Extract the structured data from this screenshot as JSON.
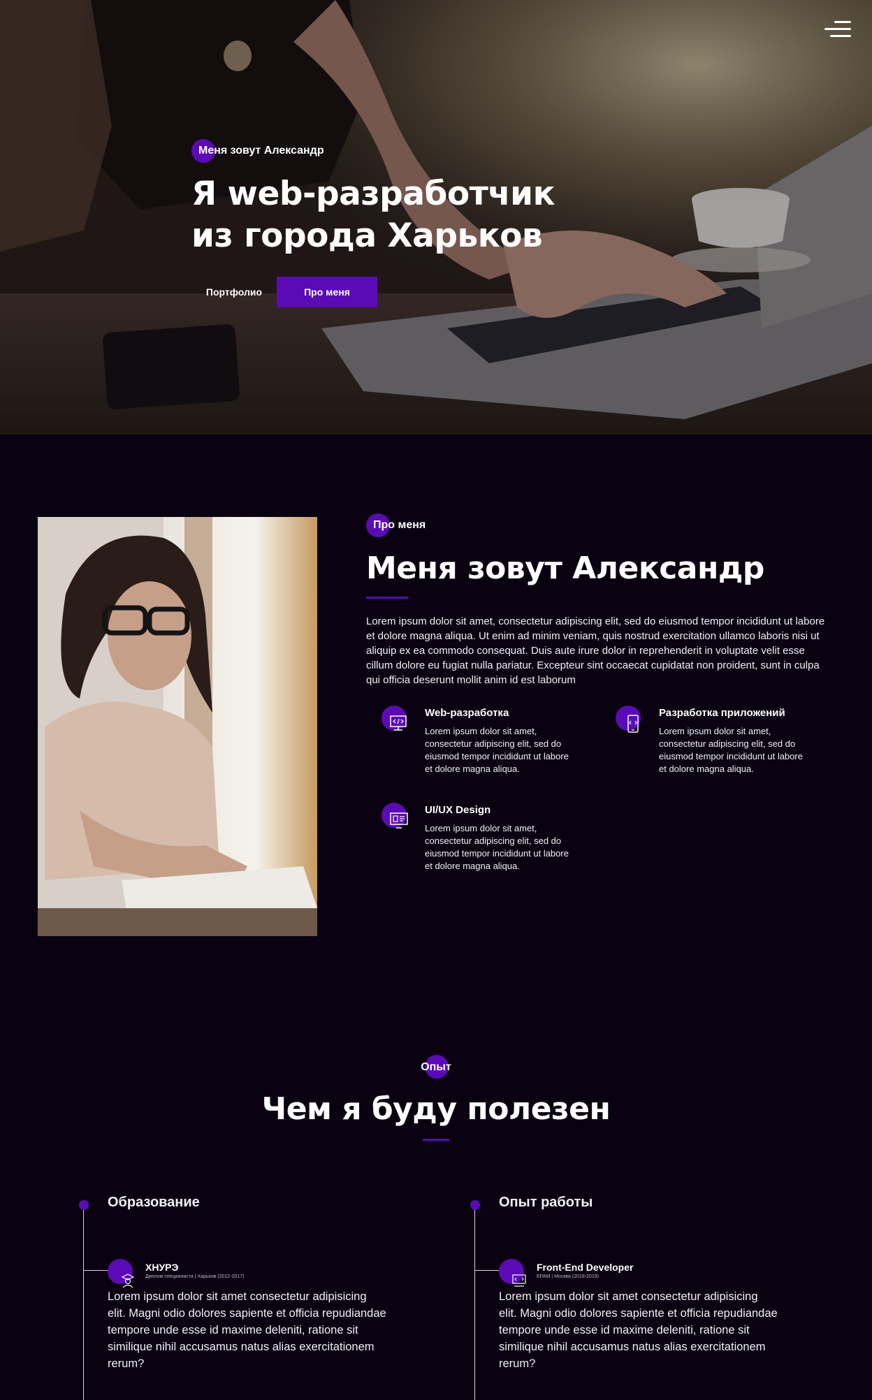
{
  "hero": {
    "tag": "Меня зовут Александр",
    "title": "Я web-разработчик из города Харьков",
    "btn_portfolio": "Портфолио",
    "btn_about": "Про меня"
  },
  "about": {
    "tag": "Про меня",
    "title": "Меня зовут Александр",
    "text": "Lorem ipsum dolor sit amet, consectetur adipiscing elit, sed do eiusmod tempor incididunt ut labore et dolore magna aliqua. Ut enim ad minim veniam, quis nostrud exercitation ullamco laboris nisi ut aliquip ex ea commodo consequat. Duis aute irure dolor in reprehenderit in voluptate velit esse cillum dolore eu fugiat nulla pariatur. Excepteur sint occaecat cupidatat non proident, sunt in culpa qui officia deserunt mollit anim id est laborum",
    "services": [
      {
        "title": "Web-разработка",
        "text": "Lorem ipsum dolor sit amet, consectetur adipiscing elit, sed do eiusmod tempor incididunt ut labore et dolore magna aliqua.",
        "icon": "monitor-code-icon"
      },
      {
        "title": "Разработка приложений",
        "text": "Lorem ipsum dolor sit amet, consectetur adipiscing elit, sed do eiusmod tempor incididunt ut labore et dolore magna aliqua.",
        "icon": "mobile-code-icon"
      },
      {
        "title": "UI/UX Design",
        "text": "Lorem ipsum dolor sit amet, consectetur adipiscing elit, sed do eiusmod tempor incididunt ut labore et dolore magna aliqua.",
        "icon": "design-monitor-icon"
      }
    ]
  },
  "experience": {
    "tag": "Опыт",
    "title": "Чем я буду полезен",
    "columns": [
      {
        "title": "Образование",
        "entry_title": "ХНУРЭ",
        "entry_sub": "Диплом специалиста | Харьков (2012-2017)",
        "entry_text": "Lorem ipsum dolor sit amet consectetur adipisicing elit. Magni odio dolores sapiente et officia repudiandae tempore unde esse id maxime deleniti, ratione sit similique nihil accusamus natus alias exercitationem rerum?",
        "icon": "graduate-icon"
      },
      {
        "title": "Опыт работы",
        "entry_title": "Front-End Developer",
        "entry_sub": "EPAM | Москва (2018-2019)",
        "entry_text": "Lorem ipsum dolor sit amet consectetur adipisicing elit. Magni odio dolores sapiente et officia repudiandae tempore unde esse id maxime deleniti, ratione sit similique nihil accusamus natus alias exercitationem rerum?",
        "icon": "developer-icon"
      }
    ]
  },
  "colors": {
    "accent": "#5a0bb5",
    "background": "#0a0211",
    "text": "#ffffff"
  }
}
